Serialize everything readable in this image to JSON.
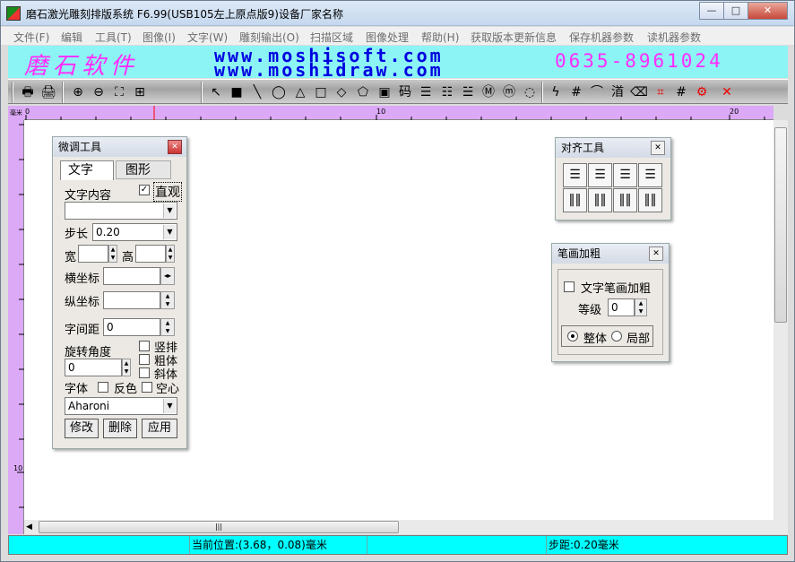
{
  "window": {
    "title": "磨石激光雕刻排版系统 F6.99(USB105左上原点版9)设备厂家名称"
  },
  "caption_buttons": {
    "minimize": "—",
    "maximize": "□",
    "close": "✕"
  },
  "menu": [
    {
      "label": "文件(F)"
    },
    {
      "label": "编辑"
    },
    {
      "label": "工具(T)"
    },
    {
      "label": "图像(I)"
    },
    {
      "label": "文字(W)"
    },
    {
      "label": "雕刻输出(O)"
    },
    {
      "label": "扫描区域"
    },
    {
      "label": "图像处理"
    },
    {
      "label": "帮助(H)"
    },
    {
      "label": "获取版本更新信息"
    },
    {
      "label": "保存机器参数"
    },
    {
      "label": "读机器参数"
    }
  ],
  "banner": {
    "brand": "磨石软件",
    "url1": "www.moshisoft.com",
    "url2": "www.moshidraw.com",
    "phone": "0635-8961024"
  },
  "toolbar": [
    {
      "name": "print-icon",
      "glyph": "🖶"
    },
    {
      "name": "print-preview-icon",
      "glyph": "🖨"
    },
    {
      "name": "zoom-in-icon",
      "glyph": "⊕"
    },
    {
      "name": "zoom-out-icon",
      "glyph": "⊖"
    },
    {
      "name": "fit-page-icon",
      "glyph": "⛶"
    },
    {
      "name": "fit-all-icon",
      "glyph": "⊞"
    },
    {
      "name": "select-arrow-icon",
      "glyph": "↖"
    },
    {
      "name": "filled-rect-icon",
      "glyph": "■"
    },
    {
      "name": "line-icon",
      "glyph": "╲"
    },
    {
      "name": "ellipse-icon",
      "glyph": "◯"
    },
    {
      "name": "triangle-icon",
      "glyph": "△"
    },
    {
      "name": "rectangle-icon",
      "glyph": "□"
    },
    {
      "name": "diamond-icon",
      "glyph": "◇"
    },
    {
      "name": "pentagon-icon",
      "glyph": "⬠"
    },
    {
      "name": "image-icon",
      "glyph": "▣"
    },
    {
      "name": "text-icon",
      "glyph": "码"
    },
    {
      "name": "vertical-text-icon",
      "glyph": "☰"
    },
    {
      "name": "text-layout-icon",
      "glyph": "☷"
    },
    {
      "name": "text-columns-icon",
      "glyph": "☱"
    },
    {
      "name": "seal-icon",
      "glyph": "Ⓜ"
    },
    {
      "name": "seal-oval-icon",
      "glyph": "ⓜ"
    },
    {
      "name": "dotted-circle-icon",
      "glyph": "◌"
    },
    {
      "name": "lightning-icon",
      "glyph": "ϟ"
    },
    {
      "name": "hash-icon",
      "glyph": "#"
    },
    {
      "name": "arc-icon",
      "glyph": "⌒"
    },
    {
      "name": "text-path-icon",
      "glyph": "渞"
    },
    {
      "name": "eraser-icon",
      "glyph": "⌫"
    },
    {
      "name": "grid-red-icon",
      "glyph": "⌗"
    },
    {
      "name": "grid-icon",
      "glyph": "#"
    },
    {
      "name": "gear-red-icon",
      "glyph": "⚙"
    },
    {
      "name": "delete-x-icon",
      "glyph": "✕"
    }
  ],
  "ruler": {
    "unit": "毫米",
    "h_labels": [
      "0",
      "10",
      "20"
    ],
    "v_labels": [
      "10"
    ]
  },
  "scroll": {
    "hthumb": "|||"
  },
  "status": {
    "cell1": "",
    "position": "当前位置:(3.68，0.08)毫米",
    "cell3": "",
    "step": "步距:0.20毫米"
  },
  "fine_tune": {
    "title": "微调工具",
    "tab_text": "文字",
    "tab_shape": "图形",
    "content_label": "文字内容",
    "direct_label": "直观",
    "direct_checked": "✓",
    "content_value": "",
    "step_label": "步长",
    "step_value": "0.20",
    "width_label": "宽",
    "height_label": "高",
    "x_label": "横坐标",
    "y_label": "纵坐标",
    "spacing_label": "字间距",
    "spacing_value": "0",
    "rotation_label": "旋转角度",
    "rotation_value": "0",
    "vertical_label": "竖排",
    "bold_label": "粗体",
    "italic_label": "斜体",
    "font_label": "字体",
    "invert_label": "反色",
    "hollow_label": "空心",
    "font_value": "Aharoni",
    "modify": "修改",
    "delete": "删除",
    "apply": "应用"
  },
  "align_tool": {
    "title": "对齐工具"
  },
  "stroke_bold": {
    "title": "笔画加粗",
    "checkbox_label": "文字笔画加粗",
    "level_label": "等级",
    "level_value": "0",
    "whole": "整体",
    "partial": "局部"
  }
}
